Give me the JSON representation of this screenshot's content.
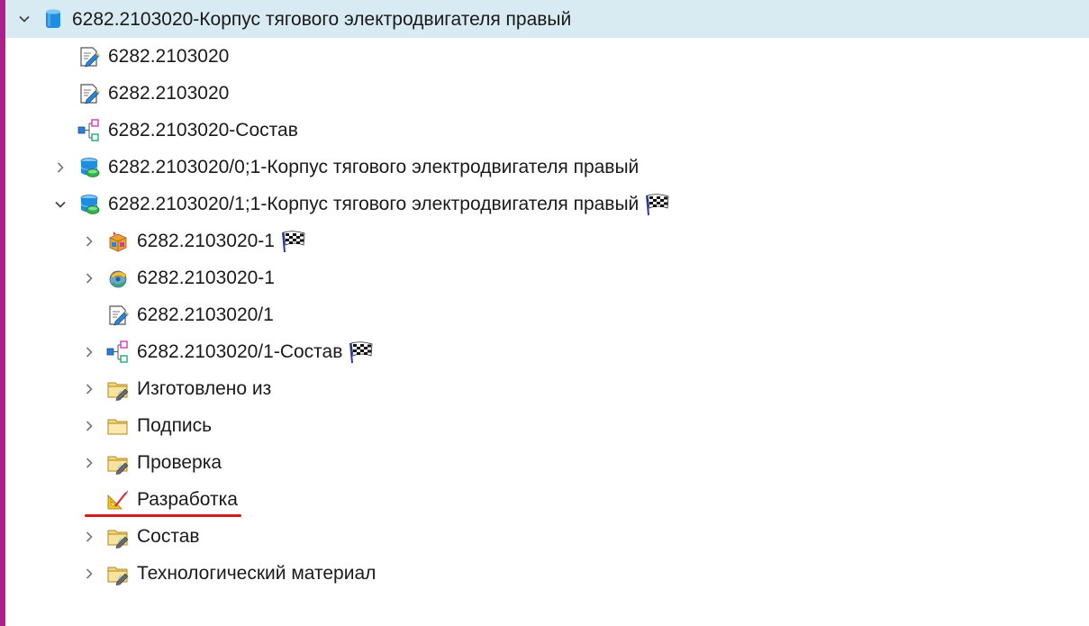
{
  "tree": {
    "rows": [
      {
        "label": "6282.2103020-Корпус тягового электродвигателя правый",
        "icon": "item-revision-cylinder-icon",
        "expander": "expanded",
        "level": 0,
        "selected": true
      },
      {
        "label": "6282.2103020",
        "icon": "document-edit-icon",
        "expander": "none",
        "level": 1
      },
      {
        "label": "6282.2103020",
        "icon": "document-edit-icon",
        "expander": "none",
        "level": 1
      },
      {
        "label": "6282.2103020-Состав",
        "icon": "structure-icon",
        "expander": "none",
        "level": 1
      },
      {
        "label": "6282.2103020/0;1-Корпус тягового электродвигателя правый",
        "icon": "database-revision-icon",
        "expander": "collapsed",
        "level": 1
      },
      {
        "label": "6282.2103020/1;1-Корпус тягового электродвигателя правый",
        "icon": "database-revision-icon",
        "expander": "expanded",
        "level": 1,
        "flag": true
      },
      {
        "label": "6282.2103020-1",
        "icon": "cube-dataset-icon",
        "expander": "collapsed",
        "level": 2,
        "flag": true
      },
      {
        "label": "6282.2103020-1",
        "icon": "cad-model-icon",
        "expander": "collapsed",
        "level": 2
      },
      {
        "label": "6282.2103020/1",
        "icon": "document-edit-icon",
        "expander": "none",
        "level": 2
      },
      {
        "label": "6282.2103020/1-Состав",
        "icon": "structure-icon",
        "expander": "collapsed",
        "level": 2,
        "flag": true
      },
      {
        "label": "Изготовлено из",
        "icon": "folder-pencil-icon",
        "expander": "collapsed",
        "level": 2
      },
      {
        "label": "Подпись",
        "icon": "folder-icon",
        "expander": "collapsed",
        "level": 2
      },
      {
        "label": "Проверка",
        "icon": "folder-pencil-icon",
        "expander": "collapsed",
        "level": 2
      },
      {
        "label": "Разработка",
        "icon": "drafting-tools-icon",
        "expander": "none",
        "level": 2,
        "underlined": true
      },
      {
        "label": "Состав",
        "icon": "folder-pencil-icon",
        "expander": "collapsed",
        "level": 2
      },
      {
        "label": "Технологический материал",
        "icon": "folder-pencil-icon",
        "expander": "collapsed",
        "level": 2
      }
    ]
  },
  "colors": {
    "selection": "#d8ebf2",
    "left_bar": "#b0208c",
    "underline": "#d21a1a"
  }
}
